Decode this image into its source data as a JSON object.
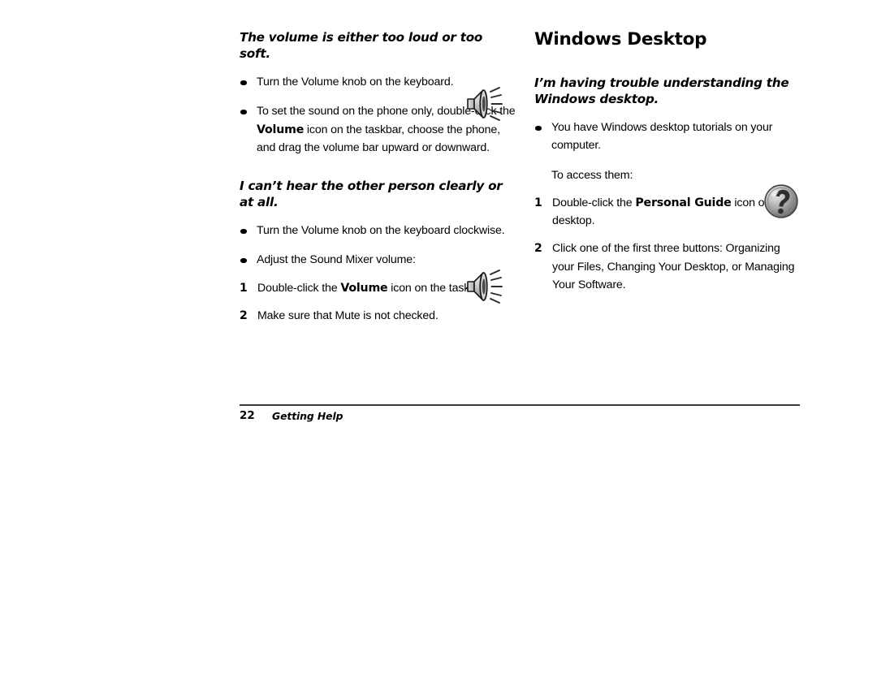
{
  "page": {
    "background": "#ffffff",
    "text_color": "#000000"
  },
  "left_column": {
    "heading_1": "The volume is either too loud or too soft.",
    "bullets_1": [
      {
        "text": "Turn the Volume knob on the keyboard."
      },
      {
        "text_before": "To set the sound on the phone only, double-click the ",
        "bold": "Volume",
        "text_after": " icon on the taskbar, choose the phone, and drag the volume bar upward or downward."
      }
    ],
    "heading_2": "I can’t hear the other person clearly or at all.",
    "bullets_2": [
      {
        "text": "Turn the Volume knob on the keyboard clockwise."
      },
      {
        "text": "Adjust the Sound Mixer volume:"
      }
    ],
    "steps": [
      {
        "num": "1",
        "text_before": "Double-click the ",
        "bold": "Volume",
        "text_after": " icon on the taskbar."
      },
      {
        "num": "2",
        "text": "Make sure that Mute is not checked."
      }
    ]
  },
  "right_column": {
    "section_title": "Windows Desktop",
    "heading_1": "I’m having trouble understanding the Windows desktop.",
    "bullets": [
      {
        "text": "You have Windows desktop tutorials on your computer."
      }
    ],
    "intro": "To access them:",
    "steps": [
      {
        "num": "1",
        "text_before": "Double-click the ",
        "bold": "Personal Guide",
        "text_after": " icon on the desktop."
      },
      {
        "num": "2",
        "text": "Click one of the first three buttons: Organizing your Files, Changing Your Desktop, or Managing Your Software."
      }
    ]
  },
  "footer": {
    "page_number": "22",
    "chapter": "Getting Help",
    "rule_color": "#3a3a3a"
  },
  "icons": {
    "speaker_1": "speaker-volume-icon",
    "speaker_2": "speaker-volume-icon",
    "personal_guide": "personal-guide-question-mark-icon"
  }
}
